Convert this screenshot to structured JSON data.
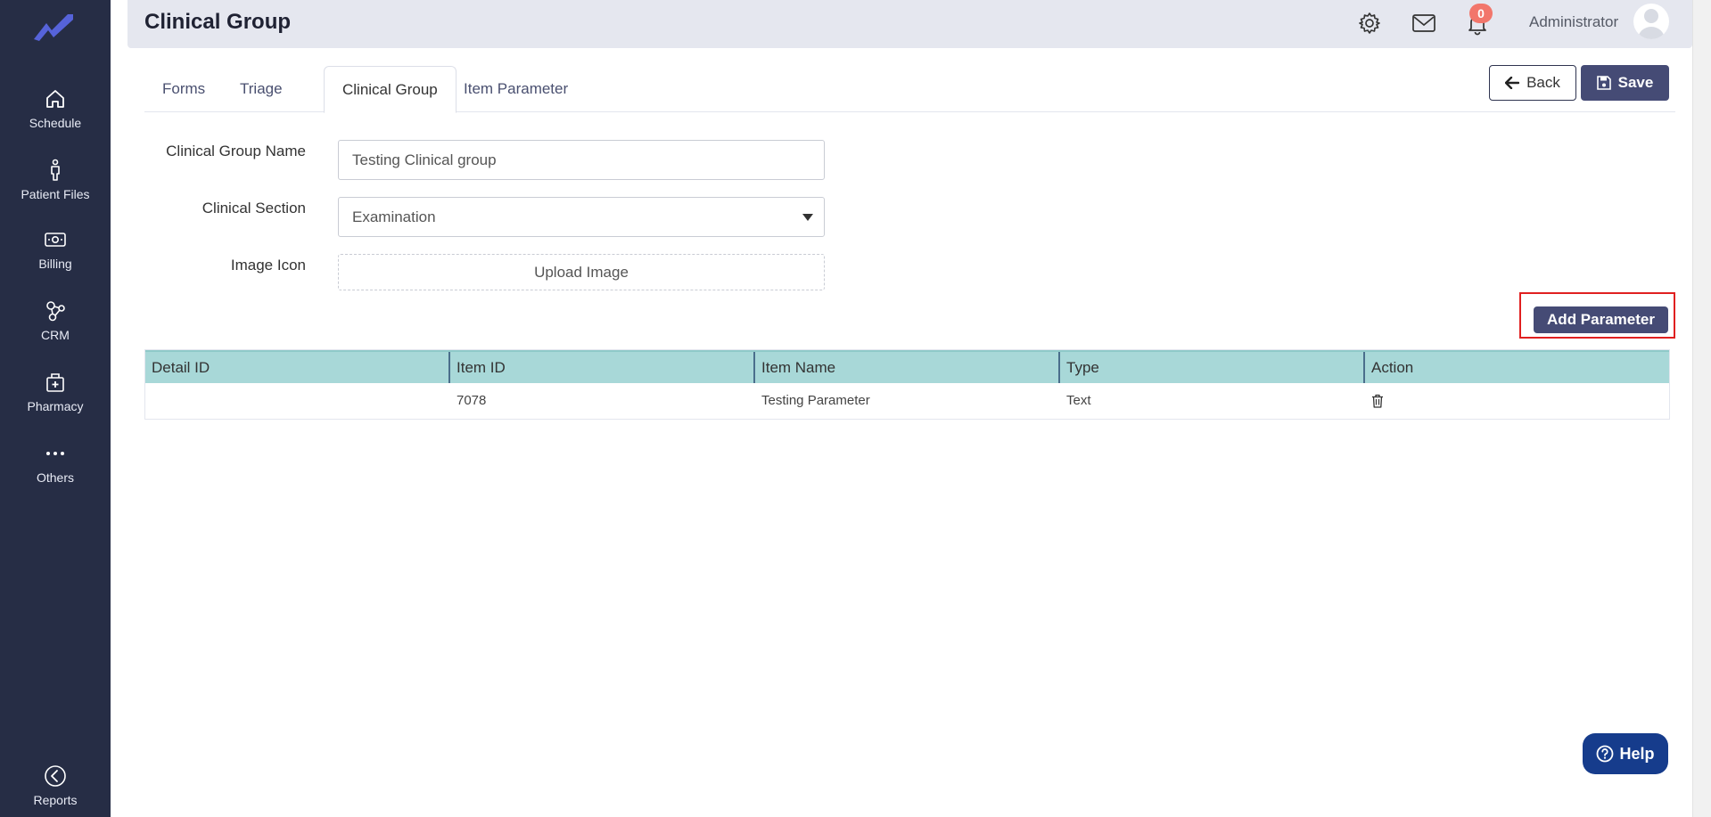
{
  "sidebar": {
    "items": [
      {
        "label": "Schedule",
        "icon": "home-icon"
      },
      {
        "label": "Patient Files",
        "icon": "person-icon"
      },
      {
        "label": "Billing",
        "icon": "money-icon"
      },
      {
        "label": "CRM",
        "icon": "crm-network-icon"
      },
      {
        "label": "Pharmacy",
        "icon": "pharmacy-icon"
      },
      {
        "label": "Others",
        "icon": "more-dots-icon"
      }
    ],
    "bottom": {
      "label": "Reports",
      "icon": "reports-back-icon"
    }
  },
  "header": {
    "title": "Clinical Group",
    "notification_count": "0",
    "user_name": "Administrator"
  },
  "tabs": [
    {
      "label": "Forms",
      "active": false
    },
    {
      "label": "Triage",
      "active": false
    },
    {
      "label": "Clinical Group",
      "active": true
    },
    {
      "label": "Item Parameter",
      "active": false
    }
  ],
  "actions": {
    "back_label": "Back",
    "save_label": "Save"
  },
  "form": {
    "group_name_label": "Clinical Group Name",
    "group_name_value": "Testing Clinical group",
    "section_label": "Clinical Section",
    "section_value": "Examination",
    "image_label": "Image Icon",
    "upload_label": "Upload Image"
  },
  "add_parameter_label": "Add Parameter",
  "table": {
    "columns": [
      "Detail ID",
      "Item ID",
      "Item Name",
      "Type",
      "Action"
    ],
    "rows": [
      {
        "detail_id": "",
        "item_id": "7078",
        "item_name": "Testing Parameter",
        "type": "Text"
      }
    ]
  },
  "help_label": "Help",
  "colors": {
    "sidebar_bg": "#262d45",
    "primary": "#454b75",
    "table_header": "#a8d8d8",
    "help_bg": "#163c8c",
    "badge": "#f2766b",
    "highlight": "#e02020"
  }
}
